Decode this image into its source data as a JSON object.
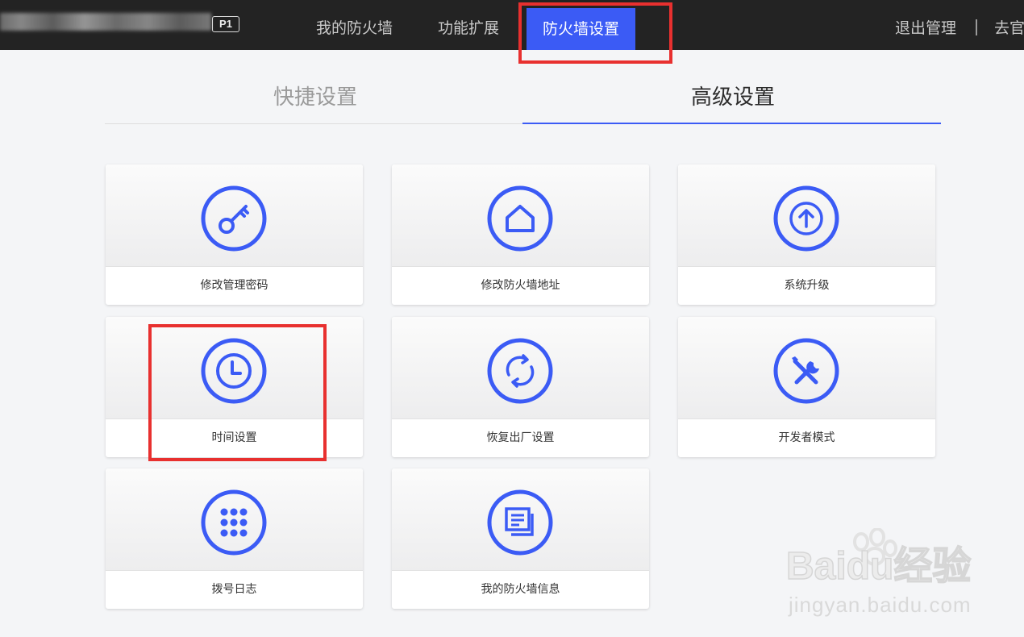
{
  "header": {
    "model_badge": "P1",
    "nav": [
      {
        "label": "我的防火墙"
      },
      {
        "label": "功能扩展"
      },
      {
        "label": "防火墙设置"
      }
    ],
    "logout": "退出管理",
    "goto": "去官"
  },
  "tabs": [
    {
      "label": "快捷设置"
    },
    {
      "label": "高级设置"
    }
  ],
  "cards": [
    {
      "label": "修改管理密码",
      "icon": "key-icon"
    },
    {
      "label": "修改防火墙地址",
      "icon": "home-icon"
    },
    {
      "label": "系统升级",
      "icon": "arrow-up-icon"
    },
    {
      "label": "时间设置",
      "icon": "clock-icon"
    },
    {
      "label": "恢复出厂设置",
      "icon": "refresh-icon"
    },
    {
      "label": "开发者模式",
      "icon": "tools-icon"
    },
    {
      "label": "拨号日志",
      "icon": "dialpad-icon"
    },
    {
      "label": "我的防火墙信息",
      "icon": "documents-icon"
    }
  ],
  "watermark": {
    "brand_text": "Baidu经验",
    "url": "jingyan.baidu.com"
  },
  "colors": {
    "accent": "#3b5bf5",
    "highlight": "#e8302f",
    "topbar": "#232323"
  }
}
